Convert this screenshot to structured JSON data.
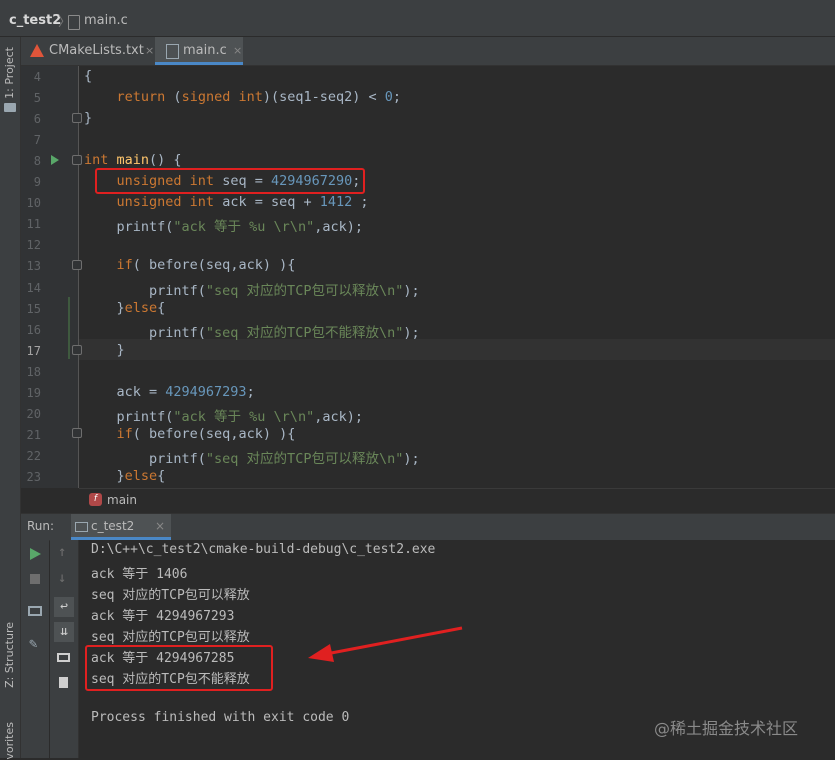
{
  "breadcrumb": {
    "project": "c_test2",
    "file": "main.c"
  },
  "sidebar": {
    "project_label": "1: Project",
    "structure_label": "Z: Structure",
    "favorites_label": "vorites"
  },
  "tabs": [
    {
      "label": "CMakeLists.txt",
      "close": "×"
    },
    {
      "label": "main.c",
      "close": "×"
    }
  ],
  "editor": {
    "lines": [
      {
        "n": "4",
        "tokens": [
          [
            "",
            "{"
          ]
        ]
      },
      {
        "n": "5",
        "tokens": [
          [
            "",
            "    "
          ],
          [
            "kw",
            "return"
          ],
          [
            "",
            " ("
          ],
          [
            "kw",
            "signed int"
          ],
          [
            "",
            ")(seq1-seq2) < "
          ],
          [
            "num",
            "0"
          ],
          [
            "",
            ";"
          ]
        ]
      },
      {
        "n": "6",
        "tokens": [
          [
            "",
            "}"
          ]
        ]
      },
      {
        "n": "7",
        "tokens": []
      },
      {
        "n": "8",
        "tokens": [
          [
            "kw",
            "int"
          ],
          [
            "",
            " "
          ],
          [
            "fn",
            "main"
          ],
          [
            "",
            "() {"
          ]
        ]
      },
      {
        "n": "9",
        "tokens": [
          [
            "",
            "    "
          ],
          [
            "kw",
            "unsigned int"
          ],
          [
            "",
            " seq = "
          ],
          [
            "num",
            "4294967290"
          ],
          [
            "",
            ";"
          ]
        ]
      },
      {
        "n": "10",
        "tokens": [
          [
            "",
            "    "
          ],
          [
            "kw",
            "unsigned int"
          ],
          [
            "",
            " ack = seq + "
          ],
          [
            "num",
            "1412"
          ],
          [
            "",
            " ;"
          ]
        ]
      },
      {
        "n": "11",
        "tokens": [
          [
            "",
            "    printf("
          ],
          [
            "str",
            "\"ack 等于 %u \\r\\n\""
          ],
          [
            "",
            ",ack);"
          ]
        ]
      },
      {
        "n": "12",
        "tokens": []
      },
      {
        "n": "13",
        "tokens": [
          [
            "",
            "    "
          ],
          [
            "kw",
            "if"
          ],
          [
            "",
            "( before(seq,ack) ){"
          ]
        ]
      },
      {
        "n": "14",
        "tokens": [
          [
            "",
            "        printf("
          ],
          [
            "str",
            "\"seq 对应的TCP包可以释放\\n\""
          ],
          [
            "",
            ");"
          ]
        ]
      },
      {
        "n": "15",
        "tokens": [
          [
            "",
            "    }"
          ],
          [
            "kw",
            "else"
          ],
          [
            "",
            "{"
          ]
        ]
      },
      {
        "n": "16",
        "tokens": [
          [
            "",
            "        printf("
          ],
          [
            "str",
            "\"seq 对应的TCP包不能释放\\n\""
          ],
          [
            "",
            ");"
          ]
        ]
      },
      {
        "n": "17",
        "tokens": [
          [
            "",
            "    }"
          ]
        ]
      },
      {
        "n": "18",
        "tokens": []
      },
      {
        "n": "19",
        "tokens": [
          [
            "",
            "    ack = "
          ],
          [
            "num",
            "4294967293"
          ],
          [
            "",
            ";"
          ]
        ]
      },
      {
        "n": "20",
        "tokens": [
          [
            "",
            "    printf("
          ],
          [
            "str",
            "\"ack 等于 %u \\r\\n\""
          ],
          [
            "",
            ",ack);"
          ]
        ]
      },
      {
        "n": "21",
        "tokens": [
          [
            "",
            "    "
          ],
          [
            "kw",
            "if"
          ],
          [
            "",
            "( before(seq,ack) ){"
          ]
        ]
      },
      {
        "n": "22",
        "tokens": [
          [
            "",
            "        printf("
          ],
          [
            "str",
            "\"seq 对应的TCP包可以释放\\n\""
          ],
          [
            "",
            ");"
          ]
        ]
      },
      {
        "n": "23",
        "tokens": [
          [
            "",
            "    }"
          ],
          [
            "kw",
            "else"
          ],
          [
            "",
            "{"
          ]
        ]
      }
    ],
    "function_crumb": "main",
    "function_icon": "f"
  },
  "run": {
    "label": "Run:",
    "tab": "c_test2",
    "tab_close": "×",
    "output": [
      "D:\\C++\\c_test2\\cmake-build-debug\\c_test2.exe",
      "ack 等于 1406",
      "seq 对应的TCP包可以释放",
      "ack 等于 4294967293",
      "seq 对应的TCP包可以释放",
      "ack 等于 4294967285",
      "seq 对应的TCP包不能释放",
      "",
      "Process finished with exit code 0"
    ]
  },
  "watermark": "@稀土掘金技术社区",
  "colors": {
    "keyword": "#cc7832",
    "number": "#6897bb",
    "string": "#6a8759",
    "function": "#ffc66d",
    "highlight": "#e02020"
  }
}
